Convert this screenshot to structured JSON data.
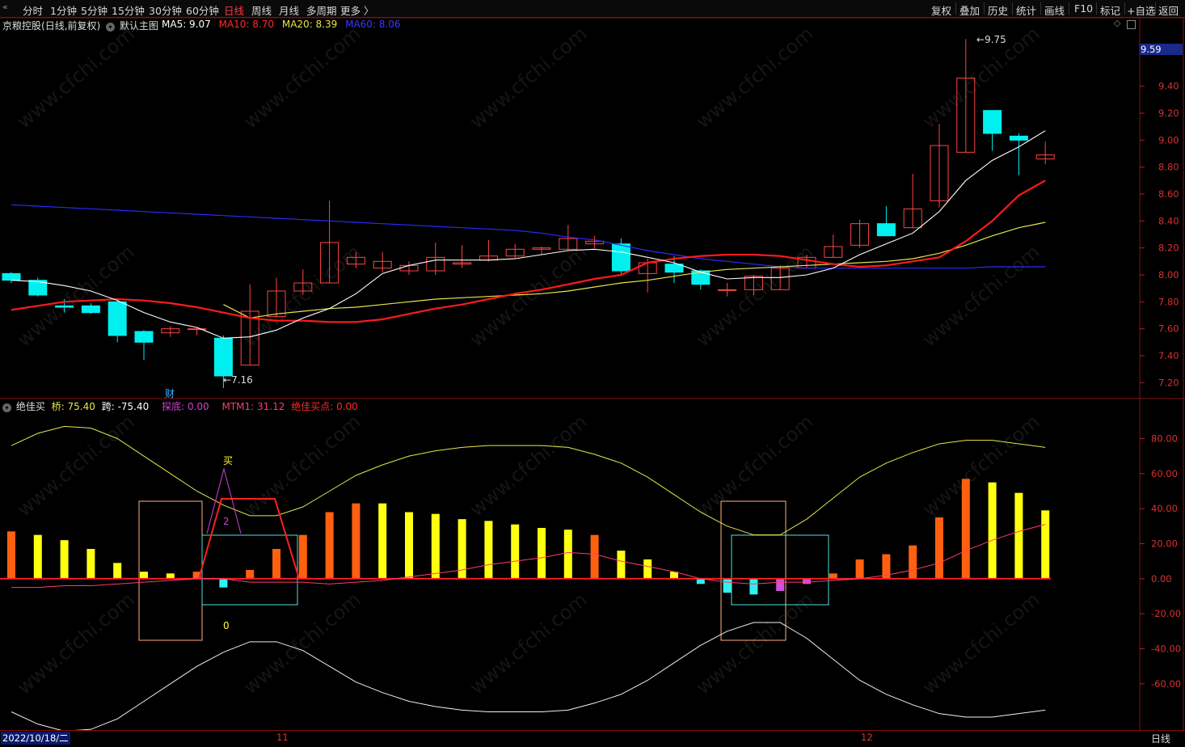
{
  "toolbar": {
    "left_tabs": [
      "分时",
      "1分钟",
      "5分钟",
      "15分钟",
      "30分钟",
      "60分钟",
      "日线",
      "周线",
      "月线",
      "多周期",
      "更多 〉"
    ],
    "active_tab": "日线",
    "right_buttons": [
      "复权",
      "叠加",
      "历史",
      "统计",
      "画线",
      "F10",
      "标记",
      "+自选",
      "返回"
    ]
  },
  "main_panel": {
    "stock_name": "京粮控股",
    "period_desc": "(日线,前复权)",
    "template_label": "默认主图",
    "ma": [
      {
        "label": "MA5: 9.07",
        "color": "#ffffff"
      },
      {
        "label": "MA10: 8.70",
        "color": "#ff2a2a"
      },
      {
        "label": "MA20: 8.39",
        "color": "#e6e64c"
      },
      {
        "label": "MA60: 8.06",
        "color": "#2a2aff"
      }
    ],
    "current_price_tag": "9.59",
    "high_annotation": "9.75",
    "low_annotation": "7.16",
    "event_marker": "财",
    "y_ticks": [
      "9.40",
      "9.20",
      "9.00",
      "8.80",
      "8.60",
      "8.40",
      "8.20",
      "8.00",
      "7.80",
      "7.60",
      "7.40",
      "7.20"
    ]
  },
  "sub_panel": {
    "indicator_name": "绝佳买",
    "values": [
      {
        "label": "桥: 75.40",
        "color": "#e6e64c"
      },
      {
        "label": "跨: -75.40",
        "color": "#ffffff"
      },
      {
        "label": "探底: 0.00",
        "color": "#d040d0"
      },
      {
        "label": "MTM1: 31.12",
        "color": "#ff3b6b"
      },
      {
        "label": "绝佳买点: 0.00",
        "color": "#ff2a2a"
      }
    ],
    "buy_label": "买",
    "num_label_2": "2",
    "num_label_0": "0",
    "y_ticks": [
      "80.00",
      "60.00",
      "40.00",
      "20.00",
      "0.00",
      "-20.00",
      "-40.00",
      "-60.00"
    ]
  },
  "bottom_axis": {
    "start_date": "2022/10/18/二",
    "month_11": "11",
    "month_12": "12",
    "period_label": "日线"
  },
  "watermark": "www.cfchi.com",
  "chart_data": {
    "type": "candlestick",
    "candles": [
      {
        "o": 8.01,
        "c": 7.96,
        "h": 8.02,
        "l": 7.94
      },
      {
        "o": 7.96,
        "c": 7.85,
        "h": 7.98,
        "l": 7.84
      },
      {
        "o": 7.77,
        "c": 7.76,
        "h": 7.82,
        "l": 7.72
      },
      {
        "o": 7.77,
        "c": 7.72,
        "h": 7.79,
        "l": 7.71
      },
      {
        "o": 7.8,
        "c": 7.55,
        "h": 7.82,
        "l": 7.5
      },
      {
        "o": 7.58,
        "c": 7.5,
        "h": 7.59,
        "l": 7.37
      },
      {
        "o": 7.57,
        "c": 7.6,
        "h": 7.62,
        "l": 7.54
      },
      {
        "o": 7.6,
        "c": 7.6,
        "h": 7.61,
        "l": 7.55
      },
      {
        "o": 7.53,
        "c": 7.25,
        "h": 7.55,
        "l": 7.16
      },
      {
        "o": 7.33,
        "c": 7.73,
        "h": 7.93,
        "l": 7.33
      },
      {
        "o": 7.69,
        "c": 7.88,
        "h": 7.98,
        "l": 7.69
      },
      {
        "o": 7.88,
        "c": 7.94,
        "h": 8.04,
        "l": 7.85
      },
      {
        "o": 7.94,
        "c": 8.24,
        "h": 8.55,
        "l": 7.94
      },
      {
        "o": 8.08,
        "c": 8.13,
        "h": 8.17,
        "l": 8.05
      },
      {
        "o": 8.05,
        "c": 8.1,
        "h": 8.17,
        "l": 8.02
      },
      {
        "o": 8.03,
        "c": 8.07,
        "h": 8.1,
        "l": 8.0
      },
      {
        "o": 8.03,
        "c": 8.13,
        "h": 8.24,
        "l": 8.0
      },
      {
        "o": 8.08,
        "c": 8.09,
        "h": 8.22,
        "l": 8.05
      },
      {
        "o": 8.11,
        "c": 8.14,
        "h": 8.26,
        "l": 8.1
      },
      {
        "o": 8.14,
        "c": 8.19,
        "h": 8.23,
        "l": 8.12
      },
      {
        "o": 8.19,
        "c": 8.2,
        "h": 8.21,
        "l": 8.15
      },
      {
        "o": 8.19,
        "c": 8.27,
        "h": 8.37,
        "l": 8.18
      },
      {
        "o": 8.23,
        "c": 8.25,
        "h": 8.29,
        "l": 8.2
      },
      {
        "o": 8.23,
        "c": 8.03,
        "h": 8.27,
        "l": 8.01
      },
      {
        "o": 8.01,
        "c": 8.09,
        "h": 8.12,
        "l": 7.87
      },
      {
        "o": 8.08,
        "c": 8.02,
        "h": 8.14,
        "l": 7.94
      },
      {
        "o": 8.03,
        "c": 7.93,
        "h": 8.04,
        "l": 7.89
      },
      {
        "o": 7.89,
        "c": 7.89,
        "h": 7.94,
        "l": 7.84
      },
      {
        "o": 7.89,
        "c": 7.99,
        "h": 8.0,
        "l": 7.85
      },
      {
        "o": 7.89,
        "c": 8.05,
        "h": 8.07,
        "l": 7.89
      },
      {
        "o": 8.05,
        "c": 8.13,
        "h": 8.15,
        "l": 8.05
      },
      {
        "o": 8.13,
        "c": 8.21,
        "h": 8.3,
        "l": 8.13
      },
      {
        "o": 8.22,
        "c": 8.38,
        "h": 8.41,
        "l": 8.2
      },
      {
        "o": 8.38,
        "c": 8.29,
        "h": 8.51,
        "l": 8.29
      },
      {
        "o": 8.35,
        "c": 8.49,
        "h": 8.75,
        "l": 8.35
      },
      {
        "o": 8.55,
        "c": 8.96,
        "h": 9.12,
        "l": 8.5
      },
      {
        "o": 8.91,
        "c": 9.46,
        "h": 9.75,
        "l": 8.91
      },
      {
        "o": 9.22,
        "c": 9.05,
        "h": 9.22,
        "l": 8.92
      },
      {
        "o": 9.03,
        "c": 9.0,
        "h": 9.05,
        "l": 8.74
      },
      {
        "o": 8.86,
        "c": 8.89,
        "h": 8.99,
        "l": 8.82
      }
    ],
    "ma5": [
      7.96,
      7.95,
      7.92,
      7.88,
      7.81,
      7.72,
      7.65,
      7.61,
      7.53,
      7.54,
      7.59,
      7.68,
      7.75,
      7.86,
      8.01,
      8.07,
      8.11,
      8.11,
      8.11,
      8.12,
      8.15,
      8.18,
      8.19,
      8.17,
      8.13,
      8.09,
      8.02,
      7.97,
      7.98,
      7.98,
      8.0,
      8.05,
      8.15,
      8.23,
      8.31,
      8.47,
      8.7,
      8.85,
      8.95,
      9.07
    ],
    "ma10": [
      7.74,
      7.77,
      7.8,
      7.81,
      7.82,
      7.81,
      7.79,
      7.76,
      7.72,
      7.68,
      7.66,
      7.66,
      7.65,
      7.65,
      7.67,
      7.71,
      7.75,
      7.78,
      7.82,
      7.86,
      7.89,
      7.93,
      7.97,
      8.0,
      8.09,
      8.12,
      8.14,
      8.15,
      8.15,
      8.14,
      8.11,
      8.08,
      8.06,
      8.07,
      8.1,
      8.13,
      8.25,
      8.4,
      8.59,
      8.7
    ],
    "ma20": [
      null,
      null,
      null,
      null,
      null,
      null,
      null,
      null,
      7.78,
      7.68,
      7.71,
      7.73,
      7.75,
      7.76,
      7.78,
      7.8,
      7.82,
      7.83,
      7.84,
      7.85,
      7.86,
      7.88,
      7.91,
      7.94,
      7.96,
      7.99,
      8.02,
      8.04,
      8.05,
      8.06,
      8.07,
      8.08,
      8.09,
      8.1,
      8.12,
      8.16,
      8.22,
      8.29,
      8.35,
      8.39
    ],
    "ma60": [
      8.52,
      8.51,
      8.5,
      8.49,
      8.48,
      8.47,
      8.46,
      8.45,
      8.44,
      8.43,
      8.42,
      8.41,
      8.4,
      8.39,
      8.38,
      8.37,
      8.36,
      8.35,
      8.34,
      8.33,
      8.31,
      8.28,
      8.26,
      8.22,
      8.18,
      8.15,
      8.12,
      8.1,
      8.08,
      8.06,
      8.05,
      8.05,
      8.05,
      8.05,
      8.05,
      8.05,
      8.05,
      8.06,
      8.06,
      8.06
    ],
    "bars": [
      27,
      25,
      22,
      17,
      9,
      4,
      3,
      4,
      -5,
      5,
      17,
      25,
      38,
      43,
      43,
      38,
      37,
      34,
      33,
      31,
      29,
      28,
      25,
      16,
      11,
      4,
      -3,
      -8,
      -9,
      -7,
      -3,
      3,
      11,
      14,
      19,
      35,
      57,
      55,
      49,
      39
    ],
    "bar_colors": [
      "o",
      "y",
      "y",
      "y",
      "y",
      "y",
      "y",
      "o",
      "c",
      "o",
      "o",
      "o",
      "o",
      "o",
      "y",
      "y",
      "y",
      "y",
      "y",
      "y",
      "y",
      "y",
      "o",
      "y",
      "y",
      "y",
      "c",
      "c",
      "c",
      "m",
      "m",
      "o",
      "o",
      "o",
      "o",
      "o",
      "o",
      "y",
      "y",
      "y"
    ],
    "qiao": [
      76,
      83,
      87,
      86,
      80,
      70,
      60,
      50,
      42,
      36,
      36,
      41,
      50,
      59,
      65,
      70,
      73,
      75,
      76,
      76,
      76,
      75,
      71,
      66,
      58,
      48,
      38,
      30,
      25,
      25,
      34,
      46,
      58,
      66,
      72,
      77,
      79,
      79,
      77,
      75
    ],
    "kua": [
      -76,
      -83,
      -87,
      -86,
      -80,
      -70,
      -60,
      -50,
      -42,
      -36,
      -36,
      -41,
      -50,
      -59,
      -65,
      -70,
      -73,
      -75,
      -76,
      -76,
      -76,
      -75,
      -71,
      -66,
      -58,
      -48,
      -38,
      -30,
      -25,
      -25,
      -34,
      -46,
      -58,
      -66,
      -72,
      -77,
      -79,
      -79,
      -77,
      -75
    ],
    "mtm": [
      -5,
      -5,
      -4,
      -4,
      -3,
      -2,
      -1,
      0,
      0,
      -2,
      -2,
      -2,
      -3,
      -2,
      -1,
      1,
      3,
      5,
      8,
      10,
      12,
      15,
      14,
      10,
      7,
      4,
      0,
      -2,
      -3,
      -2,
      -2,
      -1,
      0,
      2,
      5,
      9,
      16,
      22,
      27,
      31
    ],
    "ylim_main": [
      7.1,
      9.8
    ],
    "ylim_sub": [
      -85,
      95
    ]
  }
}
